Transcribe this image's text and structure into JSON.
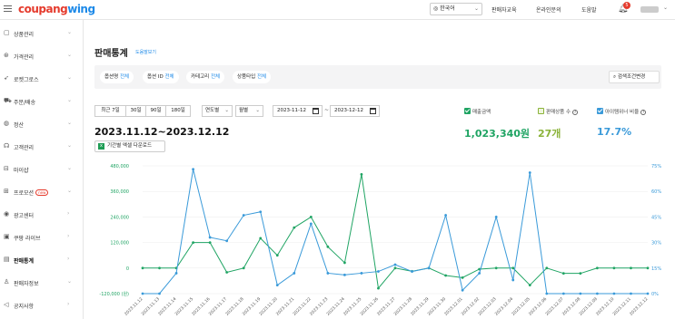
{
  "header": {
    "logo_main": "coupang",
    "logo_sub": "wing",
    "language": "한국어",
    "links": [
      "판매자교육",
      "온라인문의",
      "도움말"
    ],
    "notification_count": "5"
  },
  "sidebar": {
    "items": [
      {
        "label": "상품관리",
        "icon": "box-icon"
      },
      {
        "label": "가격관리",
        "icon": "price-tag-icon"
      },
      {
        "label": "로켓그로스",
        "icon": "rocket-icon"
      },
      {
        "label": "주문/배송",
        "icon": "truck-icon"
      },
      {
        "label": "정산",
        "icon": "money-icon"
      },
      {
        "label": "고객관리",
        "icon": "headset-icon"
      },
      {
        "label": "마이샵",
        "icon": "shop-icon"
      },
      {
        "label": "프로모션",
        "icon": "promotion-icon",
        "badge": "new"
      },
      {
        "label": "광고센터",
        "icon": "ad-icon"
      },
      {
        "label": "쿠팡 라이브",
        "icon": "live-icon"
      },
      {
        "label": "판매통계",
        "icon": "stats-icon",
        "active": true
      },
      {
        "label": "판매자정보",
        "icon": "person-icon"
      },
      {
        "label": "공지사항",
        "icon": "megaphone-icon"
      }
    ]
  },
  "page": {
    "title": "판매통계",
    "help_link": "도움말보기"
  },
  "filters": {
    "pills": [
      {
        "label": "옵션명",
        "value": "전체"
      },
      {
        "label": "옵션 ID",
        "value": "전체"
      },
      {
        "label": "카테고리",
        "value": "전체"
      },
      {
        "label": "상품타입",
        "value": "전체"
      }
    ],
    "search_conditions": "검색조건변경"
  },
  "period": {
    "buttons": [
      "최근 7일",
      "30일",
      "90일",
      "180일"
    ],
    "unit_year": "연도별",
    "unit_month": "월별",
    "start_date": "2023-11-12",
    "end_date": "2023-12-12",
    "tilde": "~"
  },
  "summary": {
    "range_title": "2023.11.12~2023.12.12",
    "excel_button": "기간별 엑셀 다운로드",
    "metrics": [
      {
        "label": "매출금액",
        "value": "1,023,340원",
        "color": "#1fa463",
        "checked": true
      },
      {
        "label": "판매상품 수",
        "value": "27개",
        "color": "#8bb33a",
        "checked": false
      },
      {
        "label": "아이템위너 비율",
        "value": "17.7%",
        "color": "#3a9ad9",
        "checked": true
      }
    ]
  },
  "chart_data": {
    "type": "line",
    "categories": [
      "2023.11.12",
      "2023.11.13",
      "2023.11.14",
      "2023.11.15",
      "2023.11.16",
      "2023.11.17",
      "2023.11.18",
      "2023.11.19",
      "2023.11.20",
      "2023.11.21",
      "2023.11.22",
      "2023.11.23",
      "2023.11.24",
      "2023.11.25",
      "2023.11.26",
      "2023.11.27",
      "2023.11.28",
      "2023.11.29",
      "2023.11.30",
      "2023.12.01",
      "2023.12.02",
      "2023.12.03",
      "2023.12.04",
      "2023.12.05",
      "2023.12.06",
      "2023.12.07",
      "2023.12.08",
      "2023.12.09",
      "2023.12.10",
      "2023.12.11",
      "2023.12.12"
    ],
    "left_axis": {
      "ticks": [
        "480,000",
        "360,000",
        "240,000",
        "120,000",
        "0",
        "-120,000 (원)"
      ],
      "min": -120000,
      "max": 480000
    },
    "right_axis": {
      "ticks": [
        "75%",
        "60%",
        "45%",
        "30%",
        "15%",
        "0%"
      ],
      "min": 0,
      "max": 75
    },
    "series": [
      {
        "name": "매출금액",
        "axis": "left",
        "color": "#1fa463",
        "values": [
          0,
          0,
          0,
          120000,
          120000,
          -20000,
          0,
          140000,
          60000,
          190000,
          240000,
          100000,
          25000,
          440000,
          -95000,
          0,
          -15000,
          0,
          -35000,
          -45000,
          -5000,
          0,
          0,
          -80000,
          0,
          -25000,
          -25000,
          0,
          0,
          0,
          0
        ]
      },
      {
        "name": "아이템위너 비율",
        "axis": "right",
        "color": "#3a9ad9",
        "values": [
          0,
          0,
          12,
          73,
          33,
          31,
          46,
          48,
          5,
          12,
          41,
          12,
          11,
          12,
          13,
          17,
          13,
          15,
          46,
          2,
          12,
          45,
          8,
          71,
          0,
          0,
          0,
          0,
          0,
          0,
          0
        ]
      }
    ]
  }
}
